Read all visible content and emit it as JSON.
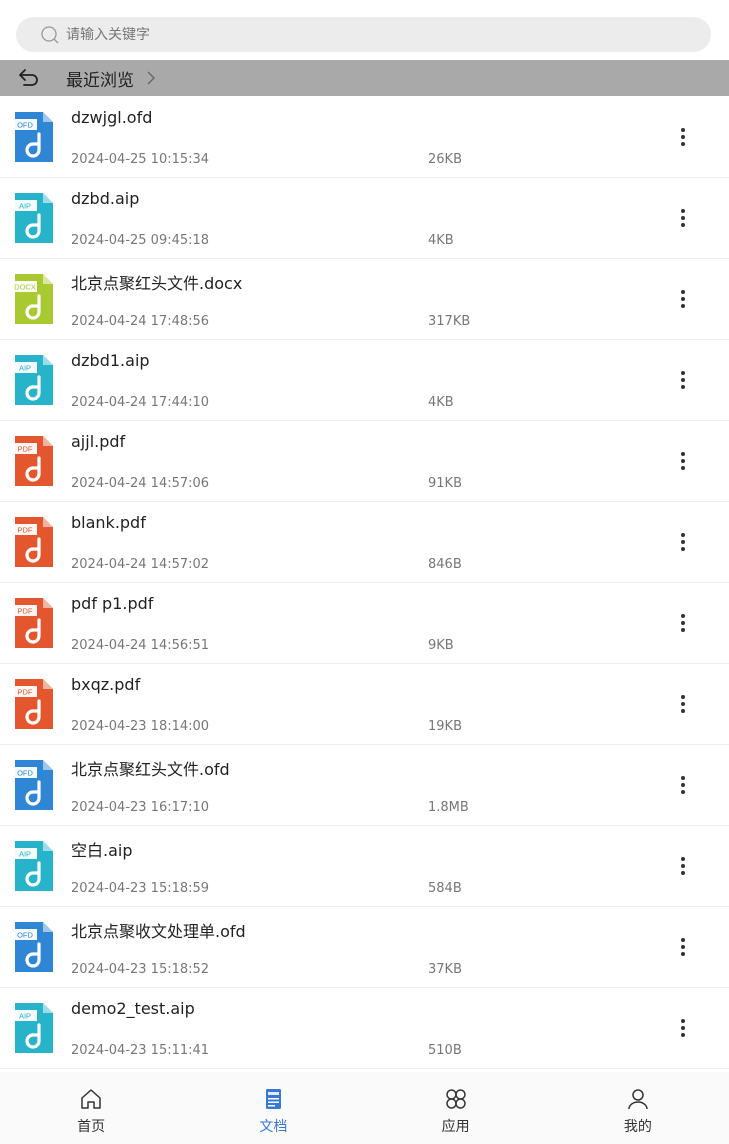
{
  "search": {
    "placeholder": "请输入关键字",
    "icon": "search-icon"
  },
  "breadcrumb": {
    "label": "最近浏览",
    "back_icon": "back-icon",
    "chevron_icon": "chevron-right-icon"
  },
  "file_type_colors": {
    "OFD": "#2f86d4",
    "AIP": "#27b3c9",
    "DOCX": "#a9c931",
    "PDF": "#e4572e"
  },
  "files": [
    {
      "name": "dzwjgl.ofd",
      "date": "2024-04-25 10:15:34",
      "size": "26KB",
      "type": "OFD"
    },
    {
      "name": "dzbd.aip",
      "date": "2024-04-25 09:45:18",
      "size": "4KB",
      "type": "AIP"
    },
    {
      "name": "北京点聚红头文件.docx",
      "date": "2024-04-24 17:48:56",
      "size": "317KB",
      "type": "DOCX"
    },
    {
      "name": "dzbd1.aip",
      "date": "2024-04-24 17:44:10",
      "size": "4KB",
      "type": "AIP"
    },
    {
      "name": "ajjl.pdf",
      "date": "2024-04-24 14:57:06",
      "size": "91KB",
      "type": "PDF"
    },
    {
      "name": "blank.pdf",
      "date": "2024-04-24 14:57:02",
      "size": "846B",
      "type": "PDF"
    },
    {
      "name": "pdf p1.pdf",
      "date": "2024-04-24 14:56:51",
      "size": "9KB",
      "type": "PDF"
    },
    {
      "name": "bxqz.pdf",
      "date": "2024-04-23 18:14:00",
      "size": "19KB",
      "type": "PDF"
    },
    {
      "name": "北京点聚红头文件.ofd",
      "date": "2024-04-23 16:17:10",
      "size": "1.8MB",
      "type": "OFD"
    },
    {
      "name": "空白.aip",
      "date": "2024-04-23 15:18:59",
      "size": "584B",
      "type": "AIP"
    },
    {
      "name": "北京点聚收文处理单.ofd",
      "date": "2024-04-23 15:18:52",
      "size": "37KB",
      "type": "OFD"
    },
    {
      "name": "demo2_test.aip",
      "date": "2024-04-23 15:11:41",
      "size": "510B",
      "type": "AIP"
    }
  ],
  "nav": [
    {
      "label": "首页",
      "icon": "home-icon",
      "active": false
    },
    {
      "label": "文档",
      "icon": "document-icon",
      "active": true
    },
    {
      "label": "应用",
      "icon": "apps-icon",
      "active": false
    },
    {
      "label": "我的",
      "icon": "profile-icon",
      "active": false
    }
  ],
  "colors": {
    "active": "#3a78d8",
    "breadcrumb_bg": "#a9a9a9",
    "search_bg": "#ececec"
  }
}
